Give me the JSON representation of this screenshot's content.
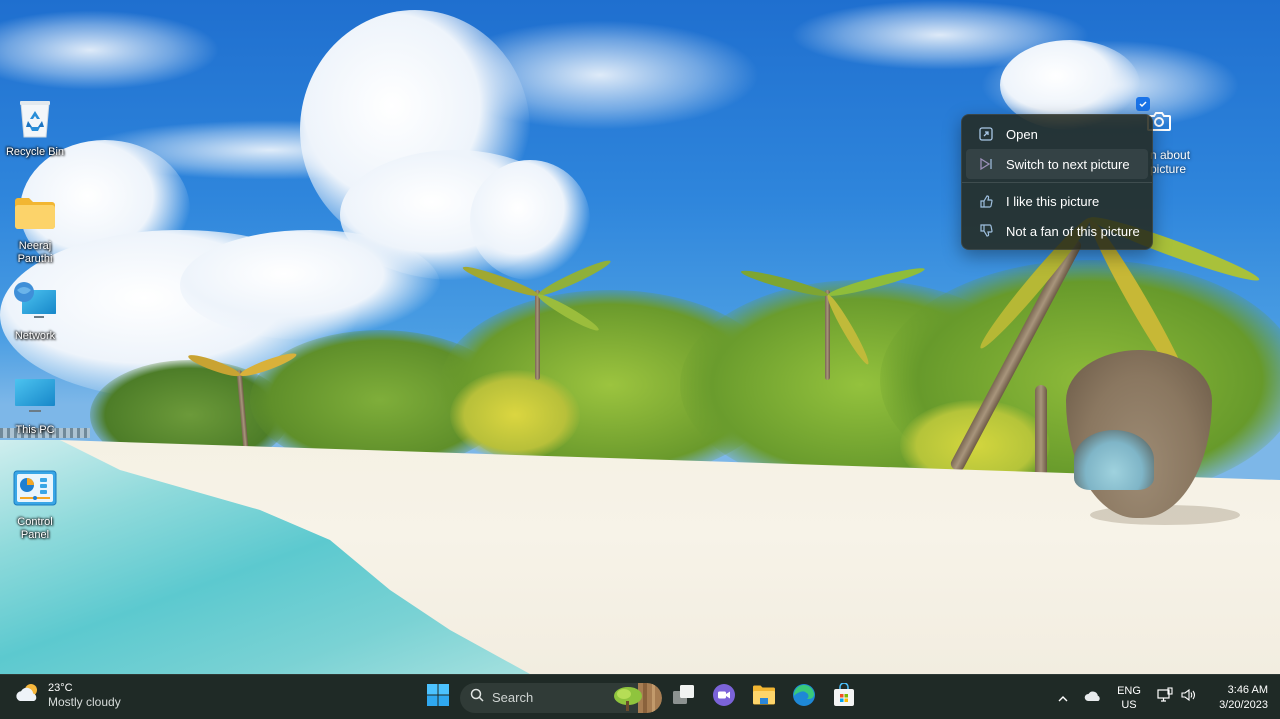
{
  "desktop": {
    "icons": [
      {
        "label": "Recycle Bin",
        "icon": "recycle-bin-icon"
      },
      {
        "label": "Neeraj Paruthi",
        "icon": "folder-icon"
      },
      {
        "label": "Network",
        "icon": "network-icon"
      },
      {
        "label": "This PC",
        "icon": "this-pc-icon"
      },
      {
        "label": "Control Panel",
        "icon": "control-panel-icon"
      }
    ]
  },
  "spotlight": {
    "label_line1": "n about",
    "label_line2": "picture",
    "icon": "camera-icon"
  },
  "context_menu": {
    "items": [
      {
        "label": "Open",
        "icon": "open-icon"
      },
      {
        "label": "Switch to next picture",
        "icon": "next-picture-icon",
        "highlighted": true
      },
      {
        "label": "I like this picture",
        "icon": "thumbs-up-icon"
      },
      {
        "label": "Not a fan of this picture",
        "icon": "thumbs-down-icon"
      }
    ]
  },
  "taskbar": {
    "weather": {
      "temperature": "23°C",
      "condition": "Mostly cloudy",
      "icon": "partly-cloudy-icon"
    },
    "search": {
      "placeholder": "Search"
    },
    "apps": [
      {
        "name": "Start",
        "icon": "windows-start-icon"
      },
      {
        "name": "Task View",
        "icon": "task-view-icon"
      },
      {
        "name": "Chat",
        "icon": "teams-chat-icon"
      },
      {
        "name": "File Explorer",
        "icon": "file-explorer-icon"
      },
      {
        "name": "Microsoft Edge",
        "icon": "edge-icon"
      },
      {
        "name": "Microsoft Store",
        "icon": "store-icon"
      }
    ],
    "tray": {
      "language_line1": "ENG",
      "language_line2": "US",
      "time": "3:46 AM",
      "date": "3/20/2023"
    }
  },
  "colors": {
    "accent": "#1a73e8",
    "taskbar_bg": "#1f2a26",
    "menu_bg": "#24281c"
  }
}
